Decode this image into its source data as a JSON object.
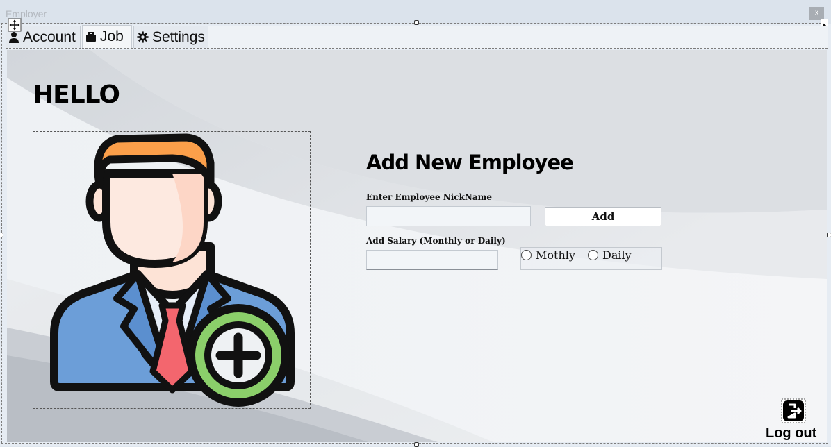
{
  "window": {
    "title": "Employer",
    "close_label": "x"
  },
  "tabs": [
    {
      "label": "Account",
      "icon": "user-icon"
    },
    {
      "label": "Job",
      "icon": "briefcase-icon"
    },
    {
      "label": "Settings",
      "icon": "gear-icon"
    }
  ],
  "main": {
    "greeting": "HELLO",
    "avatar_icon": "add-employee-icon",
    "form": {
      "title": "Add New Employee",
      "nickname_label": "Enter Employee NickName",
      "nickname_value": "",
      "add_label": "Add",
      "salary_label": "Add Salary (Monthly or Daily)",
      "salary_value": "",
      "options": [
        "Mothly",
        "Daily"
      ]
    },
    "logout_label": "Log out",
    "logout_icon": "logout-icon"
  },
  "colors": {
    "hair": "#fb9f4a",
    "skin": "#fde3d6",
    "suit": "#6c9ed8",
    "tie": "#f3666e",
    "plus_ring": "#8bcf6a"
  }
}
